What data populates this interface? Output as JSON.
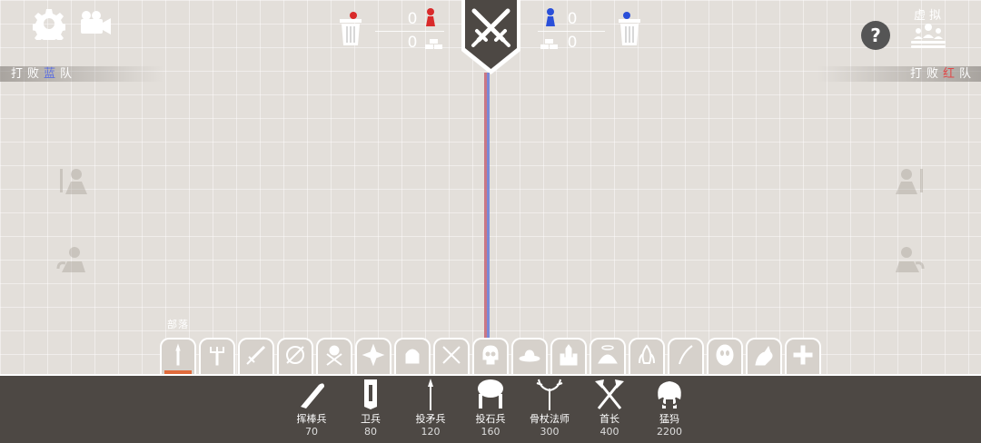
{
  "top_left": {
    "settings_icon": "gear-icon",
    "camera_icon": "camera-icon"
  },
  "defeat": {
    "left": {
      "prefix": "打败",
      "team": "蓝",
      "suffix": "队",
      "team_color": "#5b6ee0"
    },
    "right": {
      "prefix": "打败",
      "team": "红",
      "suffix": "队",
      "team_color": "#e04848"
    }
  },
  "scoreboard": {
    "red": {
      "units": "0",
      "gold": "0",
      "color": "#d92a2a"
    },
    "blue": {
      "units": "0",
      "gold": "0",
      "color": "#2a4fd9"
    }
  },
  "top_right": {
    "help": "?",
    "simulate_label": "虚拟"
  },
  "faction": {
    "label": "部落"
  },
  "tabs": [
    {
      "name": "tab-tribal",
      "icon": "spear-icon",
      "active": true
    },
    {
      "name": "tab-farmer",
      "icon": "pitchfork-icon"
    },
    {
      "name": "tab-medieval",
      "icon": "sword-icon"
    },
    {
      "name": "tab-ancient",
      "icon": "shield-icon"
    },
    {
      "name": "tab-viking",
      "icon": "viking-axe-icon"
    },
    {
      "name": "tab-dynasty",
      "icon": "shuriken-icon"
    },
    {
      "name": "tab-renaissance",
      "icon": "helmet-icon"
    },
    {
      "name": "tab-pirate",
      "icon": "crossed-sabres-icon"
    },
    {
      "name": "tab-spooky",
      "icon": "skull-icon"
    },
    {
      "name": "tab-wildwest",
      "icon": "cowboy-hat-icon"
    },
    {
      "name": "tab-legacy",
      "icon": "castle-icon"
    },
    {
      "name": "tab-good",
      "icon": "halo-icon"
    },
    {
      "name": "tab-evil",
      "icon": "flame-icon"
    },
    {
      "name": "tab-secret",
      "icon": "scythe-icon"
    },
    {
      "name": "tab-custom",
      "icon": "mask-icon"
    },
    {
      "name": "tab-extra",
      "icon": "dragon-icon"
    },
    {
      "name": "tab-add",
      "icon": "plus-icon"
    }
  ],
  "units": [
    {
      "name": "挥棒兵",
      "cost": "70",
      "icon": "club-icon"
    },
    {
      "name": "卫兵",
      "cost": "80",
      "icon": "tall-shield-icon"
    },
    {
      "name": "投矛兵",
      "cost": "120",
      "icon": "spear-icon"
    },
    {
      "name": "投石兵",
      "cost": "160",
      "icon": "boulder-icon"
    },
    {
      "name": "骨杖法师",
      "cost": "300",
      "icon": "antler-staff-icon"
    },
    {
      "name": "首长",
      "cost": "400",
      "icon": "crossed-axes-icon"
    },
    {
      "name": "猛犸",
      "cost": "2200",
      "icon": "mammoth-icon"
    }
  ]
}
